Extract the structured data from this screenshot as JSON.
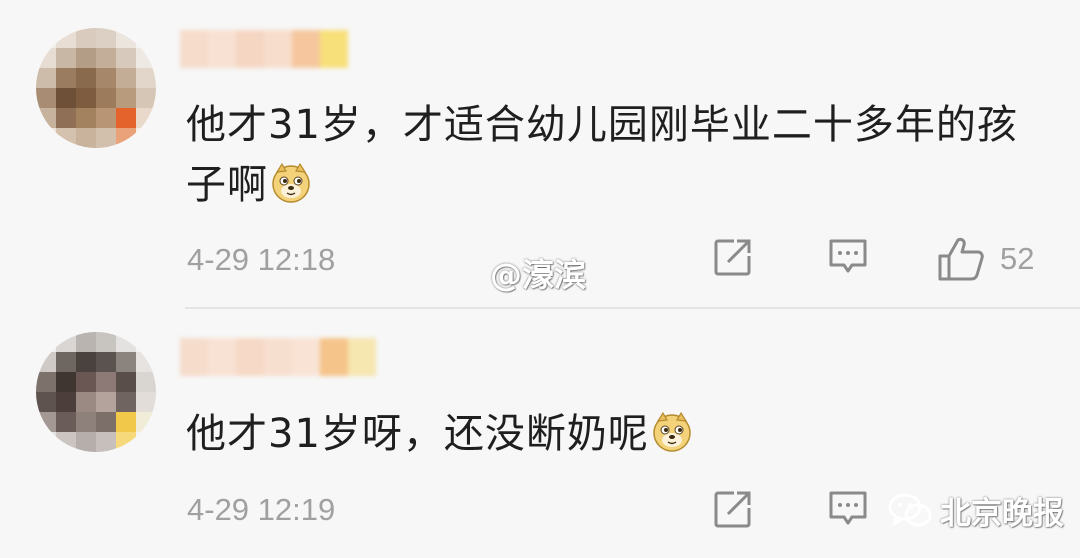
{
  "comments": [
    {
      "text": "他才31岁，才适合幼儿园刚毕业二十多年的孩子啊",
      "emoji": "doge-emoji",
      "time": "4-29 12:18",
      "actions": {
        "share_icon": "share-icon",
        "comment_icon": "comment-icon",
        "like_icon": "thumbs-up-icon",
        "like_count": "52"
      }
    },
    {
      "text": "他才31岁呀，还没断奶呢",
      "emoji": "doge-emoji",
      "time": "4-29 12:19",
      "actions": {
        "share_icon": "share-icon",
        "comment_icon": "comment-icon"
      }
    }
  ],
  "watermarks": {
    "center": "@濠滨",
    "corner": "北京晚报"
  },
  "colors": {
    "background": "#f7f7f7",
    "text": "#1f1f1f",
    "meta": "#a0a0a0",
    "icon": "#888888"
  }
}
